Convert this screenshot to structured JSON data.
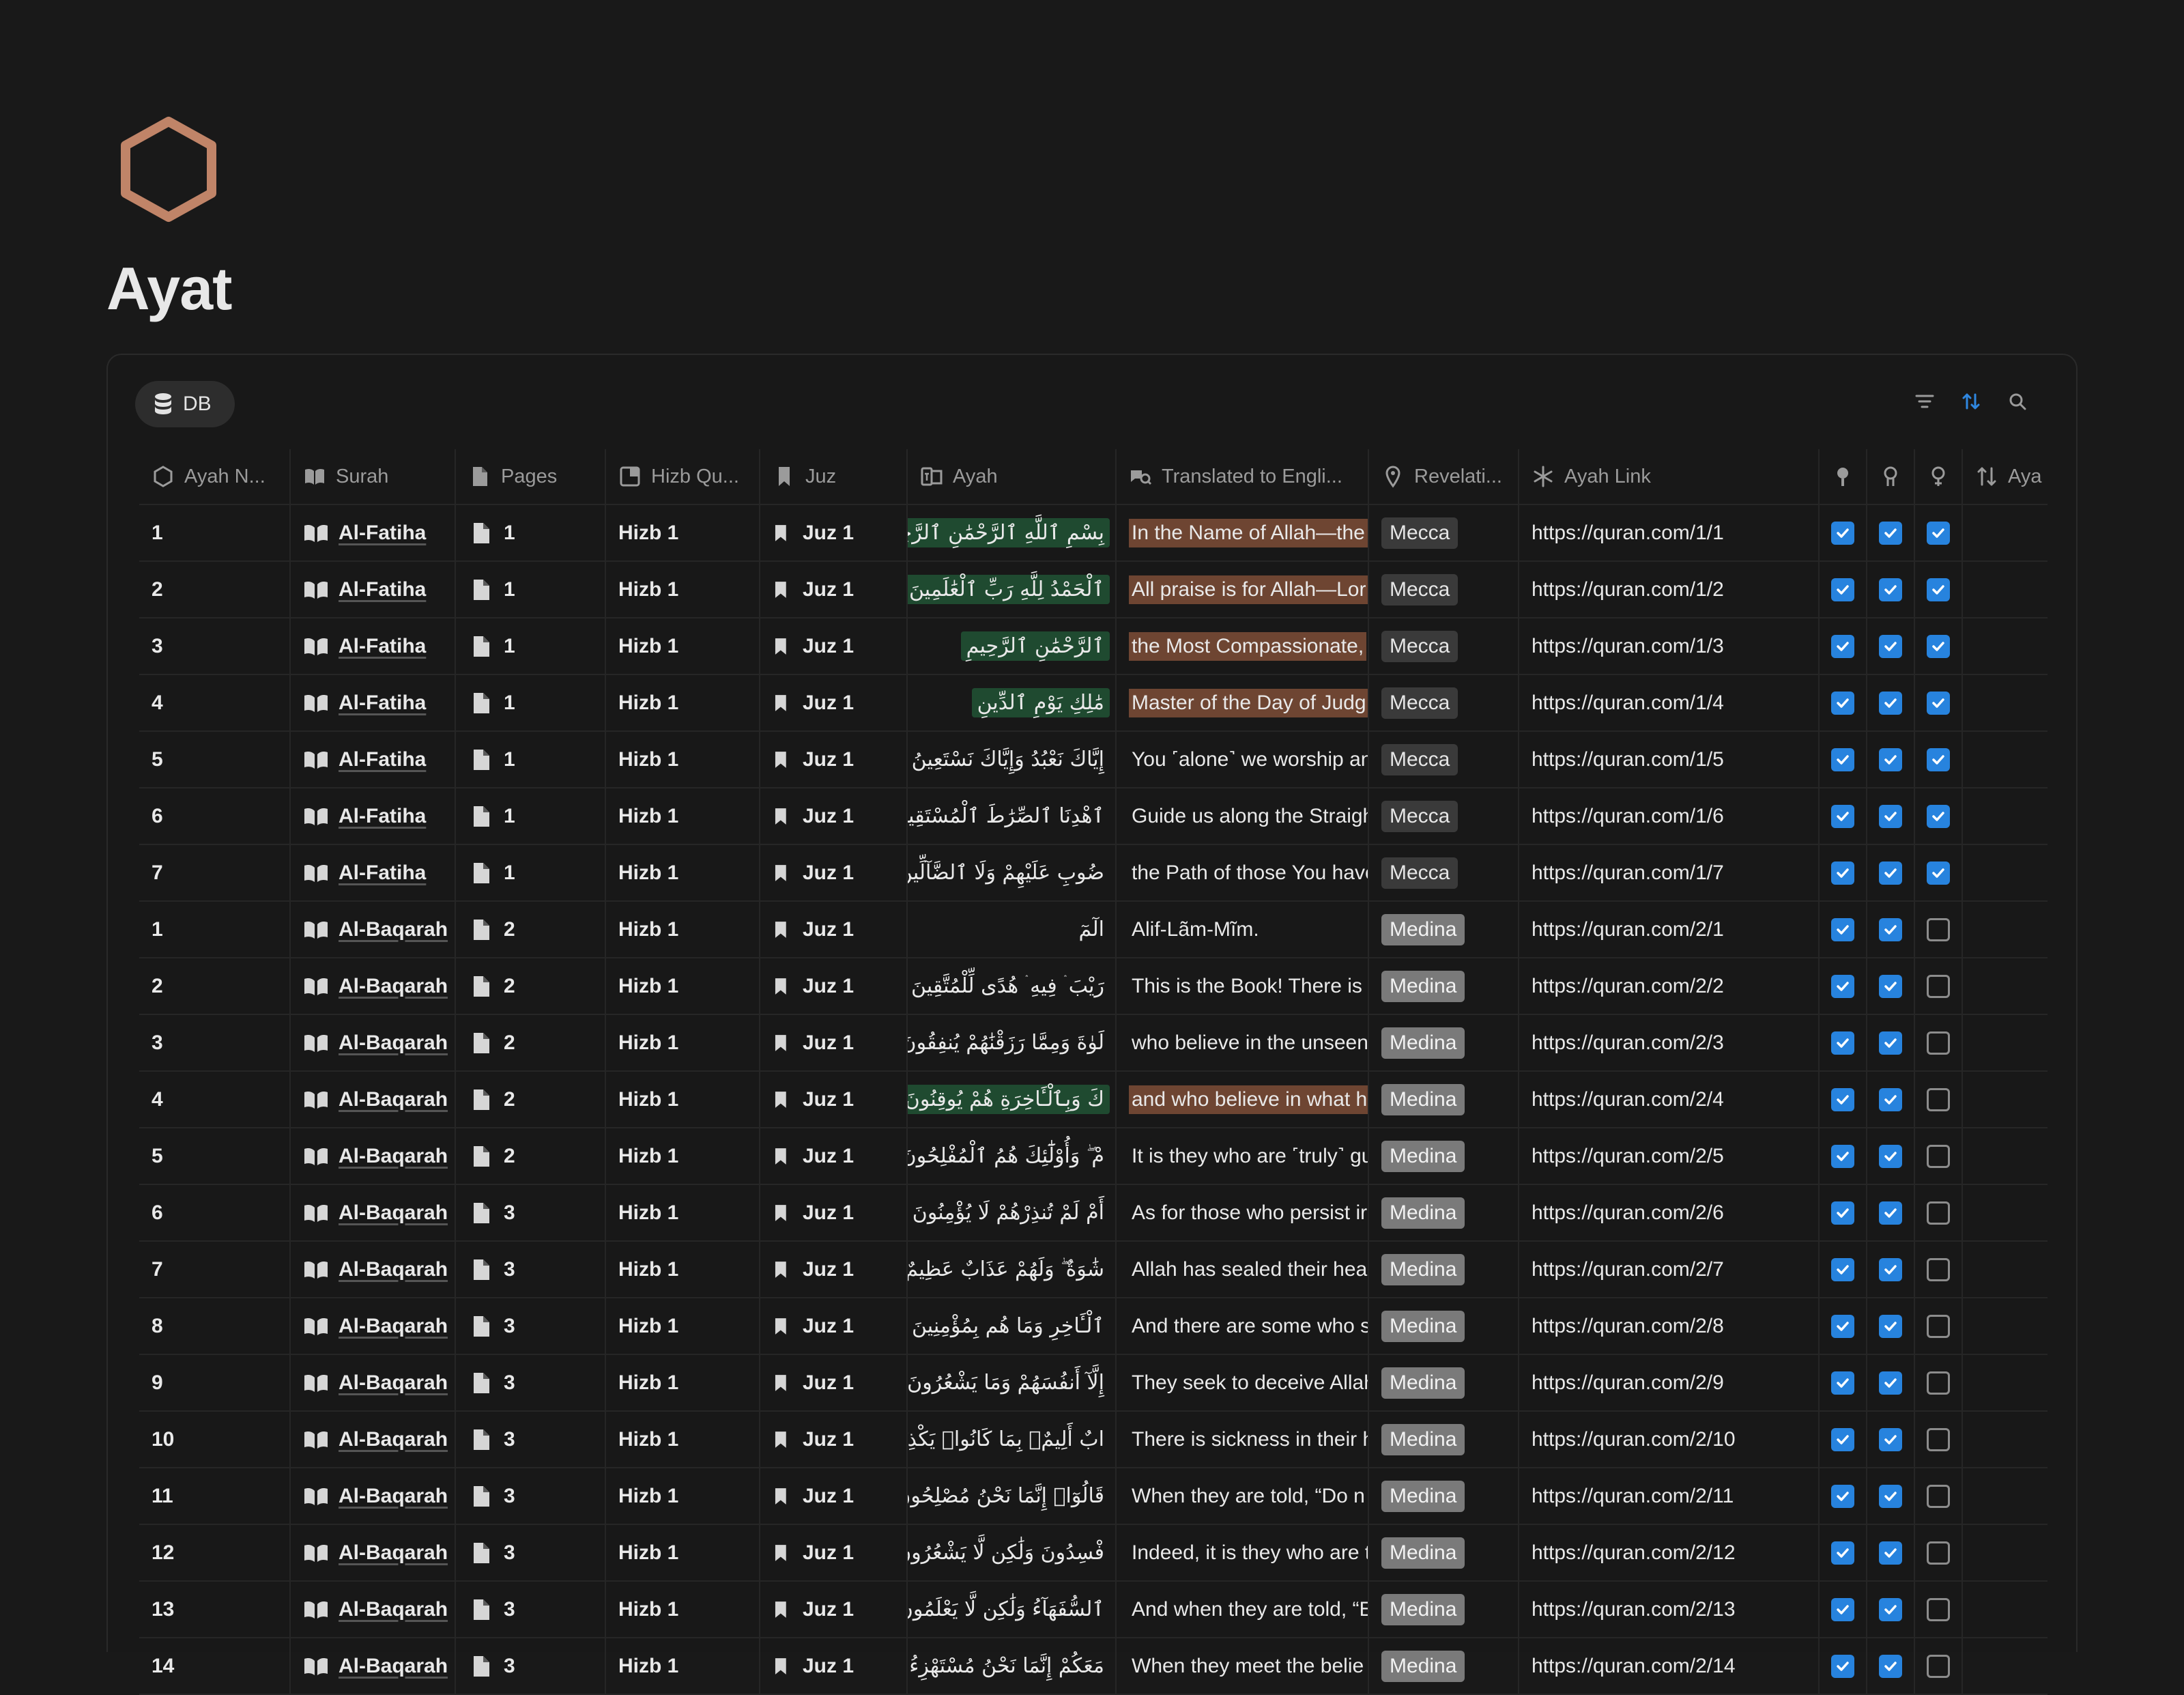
{
  "page": {
    "title": "Ayat",
    "icon": "hexagon-icon",
    "icon_color": "#c08468"
  },
  "view": {
    "tab_label": "DB",
    "tab_icon": "database-icon"
  },
  "toolbar": {
    "icons": [
      "filter-icon",
      "sort-icon",
      "search-icon"
    ],
    "sort_active_color": "#2f87e0"
  },
  "columns": [
    {
      "label": "Ayah N...",
      "icon": "hexagon-icon"
    },
    {
      "label": "Surah",
      "icon": "book-icon"
    },
    {
      "label": "Pages",
      "icon": "page-icon"
    },
    {
      "label": "Hizb Qu...",
      "icon": "quarter-icon"
    },
    {
      "label": "Juz",
      "icon": "bookmark-icon"
    },
    {
      "label": "Ayah",
      "icon": "translate-icon"
    },
    {
      "label": "Translated to Engli...",
      "icon": "translate-search-icon"
    },
    {
      "label": "Revelati...",
      "icon": "pin-icon"
    },
    {
      "label": "Ayah Link",
      "icon": "asterisk-icon"
    },
    {
      "label": "",
      "icon": "person-1-icon"
    },
    {
      "label": "",
      "icon": "person-2-icon"
    },
    {
      "label": "",
      "icon": "person-3-icon"
    },
    {
      "label": "Aya",
      "icon": "sort-arrows-icon"
    }
  ],
  "colors": {
    "arabic_highlight": "#1f4a30",
    "translation_highlight": "#6e4532",
    "checkbox_on": "#2783de",
    "mecca_badge": "#3a3a3a",
    "medina_badge": "#7a7a7a"
  },
  "rows": [
    {
      "num": "1",
      "surah": "Al-Fatiha",
      "page": "1",
      "hizb": "Hizb 1",
      "juz": "Juz 1",
      "ayah": "بِسْمِ ٱللَّهِ ٱلرَّحْمَٰنِ ٱلرَّحِيمِ",
      "ayah_hl": true,
      "translation": "In the Name of Allah—the",
      "tr_hl": true,
      "revelation": "Mecca",
      "link": "https://quran.com/1/1",
      "c1": true,
      "c2": true,
      "c3": true
    },
    {
      "num": "2",
      "surah": "Al-Fatiha",
      "page": "1",
      "hizb": "Hizb 1",
      "juz": "Juz 1",
      "ayah": "ٱلْحَمْدُ لِلَّهِ رَبِّ ٱلْعَٰلَمِينَ",
      "ayah_hl": true,
      "translation": "All praise is for Allah—Lor",
      "tr_hl": true,
      "revelation": "Mecca",
      "link": "https://quran.com/1/2",
      "c1": true,
      "c2": true,
      "c3": true
    },
    {
      "num": "3",
      "surah": "Al-Fatiha",
      "page": "1",
      "hizb": "Hizb 1",
      "juz": "Juz 1",
      "ayah": "ٱلرَّحْمَٰنِ ٱلرَّحِيمِ",
      "ayah_hl": true,
      "translation": "the Most Compassionate,",
      "tr_hl": true,
      "revelation": "Mecca",
      "link": "https://quran.com/1/3",
      "c1": true,
      "c2": true,
      "c3": true
    },
    {
      "num": "4",
      "surah": "Al-Fatiha",
      "page": "1",
      "hizb": "Hizb 1",
      "juz": "Juz 1",
      "ayah": "مَٰلِكِ يَوْمِ ٱلدِّينِ",
      "ayah_hl": true,
      "translation": "Master of the Day of Judg",
      "tr_hl": true,
      "revelation": "Mecca",
      "link": "https://quran.com/1/4",
      "c1": true,
      "c2": true,
      "c3": true
    },
    {
      "num": "5",
      "surah": "Al-Fatiha",
      "page": "1",
      "hizb": "Hizb 1",
      "juz": "Juz 1",
      "ayah": "إِيَّاكَ نَعْبُدُ وَإِيَّاكَ نَسْتَعِينُ",
      "ayah_hl": false,
      "translation": "You ˹alone˺ we worship an",
      "tr_hl": false,
      "revelation": "Mecca",
      "link": "https://quran.com/1/5",
      "c1": true,
      "c2": true,
      "c3": true
    },
    {
      "num": "6",
      "surah": "Al-Fatiha",
      "page": "1",
      "hizb": "Hizb 1",
      "juz": "Juz 1",
      "ayah": "ٱهْدِنَا ٱلصِّرَٰطَ ٱلْمُسْتَقِيمَ",
      "ayah_hl": false,
      "translation": "Guide us along the Straigh",
      "tr_hl": false,
      "revelation": "Mecca",
      "link": "https://quran.com/1/6",
      "c1": true,
      "c2": true,
      "c3": true
    },
    {
      "num": "7",
      "surah": "Al-Fatiha",
      "page": "1",
      "hizb": "Hizb 1",
      "juz": "Juz 1",
      "ayah": "ضُوبِ عَلَيْهِمْ وَلَا ٱلضَّآلِّينَ",
      "ayah_hl": false,
      "translation": "the Path of those You have",
      "tr_hl": false,
      "revelation": "Mecca",
      "link": "https://quran.com/1/7",
      "c1": true,
      "c2": true,
      "c3": true
    },
    {
      "num": "1",
      "surah": "Al-Baqarah",
      "page": "2",
      "hizb": "Hizb 1",
      "juz": "Juz 1",
      "ayah": "الٓمٓ",
      "ayah_hl": false,
      "translation": "Alif-Lãm-Mĩm.",
      "tr_hl": false,
      "revelation": "Medina",
      "link": "https://quran.com/2/1",
      "c1": true,
      "c2": true,
      "c3": false
    },
    {
      "num": "2",
      "surah": "Al-Baqarah",
      "page": "2",
      "hizb": "Hizb 1",
      "juz": "Juz 1",
      "ayah": "رَيْبَ ۛ فِيهِ ۛ هُدًى لِّلْمُتَّقِينَ",
      "ayah_hl": false,
      "translation": "This is the Book! There is n",
      "tr_hl": false,
      "revelation": "Medina",
      "link": "https://quran.com/2/2",
      "c1": true,
      "c2": true,
      "c3": false
    },
    {
      "num": "3",
      "surah": "Al-Baqarah",
      "page": "2",
      "hizb": "Hizb 1",
      "juz": "Juz 1",
      "ayah": "لَوٰةَ وَمِمَّا رَزَقْنَٰهُمْ يُنفِقُونَ",
      "ayah_hl": false,
      "translation": "who believe in the unseen",
      "tr_hl": false,
      "revelation": "Medina",
      "link": "https://quran.com/2/3",
      "c1": true,
      "c2": true,
      "c3": false
    },
    {
      "num": "4",
      "surah": "Al-Baqarah",
      "page": "2",
      "hizb": "Hizb 1",
      "juz": "Juz 1",
      "ayah": "كَ وَبِٱلْـَٔاخِرَةِ هُمْ يُوقِنُونَ",
      "ayah_hl": true,
      "translation": "and who believe in what h",
      "tr_hl": true,
      "revelation": "Medina",
      "link": "https://quran.com/2/4",
      "c1": true,
      "c2": true,
      "c3": false
    },
    {
      "num": "5",
      "surah": "Al-Baqarah",
      "page": "2",
      "hizb": "Hizb 1",
      "juz": "Juz 1",
      "ayah": "مْ ۖ وَأُوْلَٰٓئِكَ هُمُ ٱلْمُفْلِحُونَ",
      "ayah_hl": false,
      "translation": "It is they who are ˹truly˺ gu",
      "tr_hl": false,
      "revelation": "Medina",
      "link": "https://quran.com/2/5",
      "c1": true,
      "c2": true,
      "c3": false
    },
    {
      "num": "6",
      "surah": "Al-Baqarah",
      "page": "3",
      "hizb": "Hizb 1",
      "juz": "Juz 1",
      "ayah": "أَمْ لَمْ تُنذِرْهُمْ لَا يُؤْمِنُونَ",
      "ayah_hl": false,
      "translation": "As for those who persist ir",
      "tr_hl": false,
      "revelation": "Medina",
      "link": "https://quran.com/2/6",
      "c1": true,
      "c2": true,
      "c3": false
    },
    {
      "num": "7",
      "surah": "Al-Baqarah",
      "page": "3",
      "hizb": "Hizb 1",
      "juz": "Juz 1",
      "ayah": "شَٰوَةٌ ۖ وَلَهُمْ عَذَابٌ عَظِيمٌ",
      "ayah_hl": false,
      "translation": "Allah has sealed their hear",
      "tr_hl": false,
      "revelation": "Medina",
      "link": "https://quran.com/2/7",
      "c1": true,
      "c2": true,
      "c3": false
    },
    {
      "num": "8",
      "surah": "Al-Baqarah",
      "page": "3",
      "hizb": "Hizb 1",
      "juz": "Juz 1",
      "ayah": "ٱلْـَٔاخِرِ وَمَا هُم بِمُؤْمِنِينَ",
      "ayah_hl": false,
      "translation": "And there are some who s",
      "tr_hl": false,
      "revelation": "Medina",
      "link": "https://quran.com/2/8",
      "c1": true,
      "c2": true,
      "c3": false
    },
    {
      "num": "9",
      "surah": "Al-Baqarah",
      "page": "3",
      "hizb": "Hizb 1",
      "juz": "Juz 1",
      "ayah": "إِلَّآ أَنفُسَهُمْ وَمَا يَشْعُرُونَ",
      "ayah_hl": false,
      "translation": "They seek to deceive Allah",
      "tr_hl": false,
      "revelation": "Medina",
      "link": "https://quran.com/2/9",
      "c1": true,
      "c2": true,
      "c3": false
    },
    {
      "num": "10",
      "surah": "Al-Baqarah",
      "page": "3",
      "hizb": "Hizb 1",
      "juz": "Juz 1",
      "ayah": "ابٌ أَلِيمٌۢ بِمَا كَانُوا۟ يَكْذِبُونَ",
      "ayah_hl": false,
      "translation": "There is sickness in their h",
      "tr_hl": false,
      "revelation": "Medina",
      "link": "https://quran.com/2/10",
      "c1": true,
      "c2": true,
      "c3": false
    },
    {
      "num": "11",
      "surah": "Al-Baqarah",
      "page": "3",
      "hizb": "Hizb 1",
      "juz": "Juz 1",
      "ayah": "قَالُوٓا۟ إِنَّمَا نَحْنُ مُصْلِحُونَ",
      "ayah_hl": false,
      "translation": "When they are told, “Do n",
      "tr_hl": false,
      "revelation": "Medina",
      "link": "https://quran.com/2/11",
      "c1": true,
      "c2": true,
      "c3": false
    },
    {
      "num": "12",
      "surah": "Al-Baqarah",
      "page": "3",
      "hizb": "Hizb 1",
      "juz": "Juz 1",
      "ayah": "فْسِدُونَ وَلَٰكِن لَّا يَشْعُرُونَ",
      "ayah_hl": false,
      "translation": "Indeed, it is they who are t",
      "tr_hl": false,
      "revelation": "Medina",
      "link": "https://quran.com/2/12",
      "c1": true,
      "c2": true,
      "c3": false
    },
    {
      "num": "13",
      "surah": "Al-Baqarah",
      "page": "3",
      "hizb": "Hizb 1",
      "juz": "Juz 1",
      "ayah": "ٱلسُّفَهَآءُ وَلَٰكِن لَّا يَعْلَمُونَ",
      "ayah_hl": false,
      "translation": "And when they are told, “E",
      "tr_hl": false,
      "revelation": "Medina",
      "link": "https://quran.com/2/13",
      "c1": true,
      "c2": true,
      "c3": false
    },
    {
      "num": "14",
      "surah": "Al-Baqarah",
      "page": "3",
      "hizb": "Hizb 1",
      "juz": "Juz 1",
      "ayah": "مَعَكُمْ إِنَّمَا نَحْنُ مُسْتَهْزِءُونَ",
      "ayah_hl": false,
      "translation": "When they meet the belie",
      "tr_hl": false,
      "revelation": "Medina",
      "link": "https://quran.com/2/14",
      "c1": true,
      "c2": true,
      "c3": false
    }
  ]
}
